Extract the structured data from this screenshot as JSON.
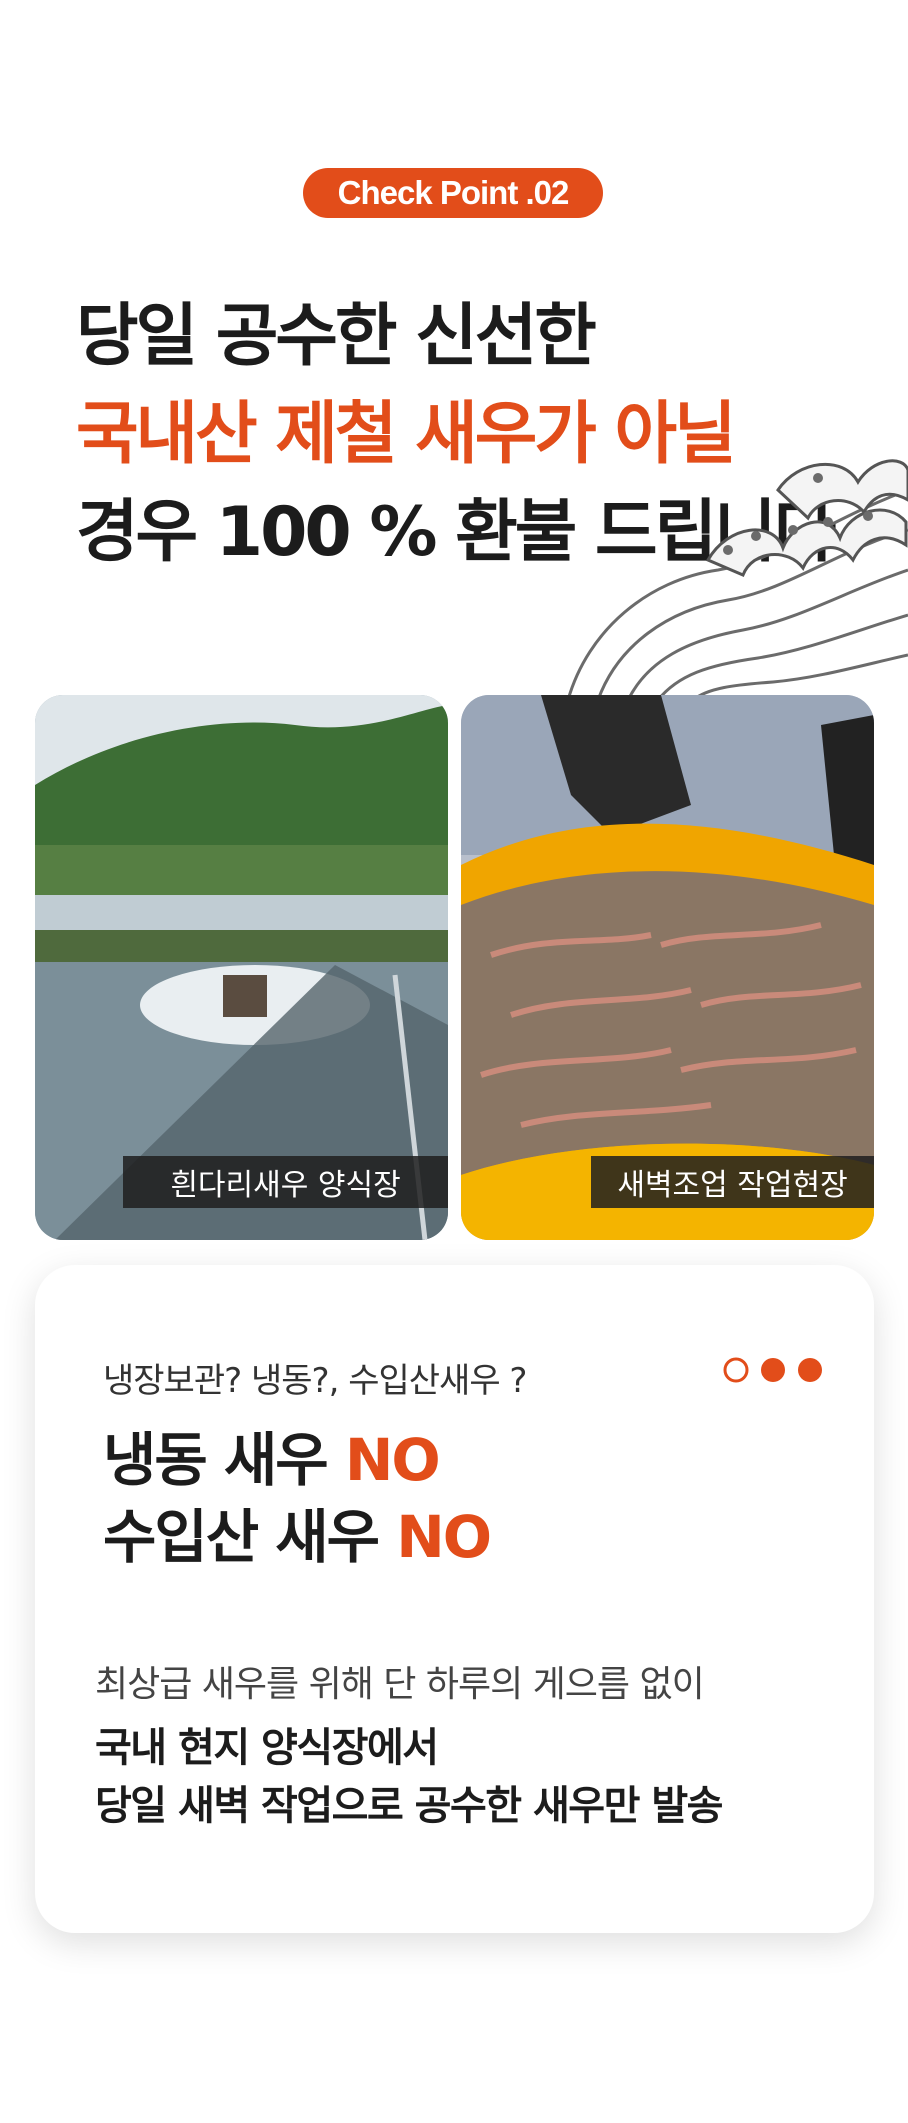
{
  "badge": "Check Point .02",
  "headline": {
    "line1": "당일 공수한 신선한",
    "line2": "국내산 제철 새우가 아닐",
    "line3": "경우 100 % 환불 드립니다"
  },
  "photos": {
    "left_caption": "흰다리새우 양식장",
    "right_caption": "새벽조업 작업현장"
  },
  "card": {
    "question": "냉장보관? 냉동?, 수입산새우 ?",
    "no_line1_text": "냉동 새우 ",
    "no_line1_accent": "NO",
    "no_line2_text": "수입산 새우 ",
    "no_line2_accent": "NO",
    "subtext": "최상급 새우를 위해  단 하루의 게으름 없이",
    "body_line1": "국내 현지 양식장에서",
    "body_line2": "당일 새벽 작업으로 공수한 새우만 발송"
  },
  "colors": {
    "accent": "#e24d1a",
    "text": "#1c1c1c",
    "caption_bg": "#1e1e1e"
  },
  "icons": [
    "wave-illustration",
    "progress-dots-icon"
  ]
}
